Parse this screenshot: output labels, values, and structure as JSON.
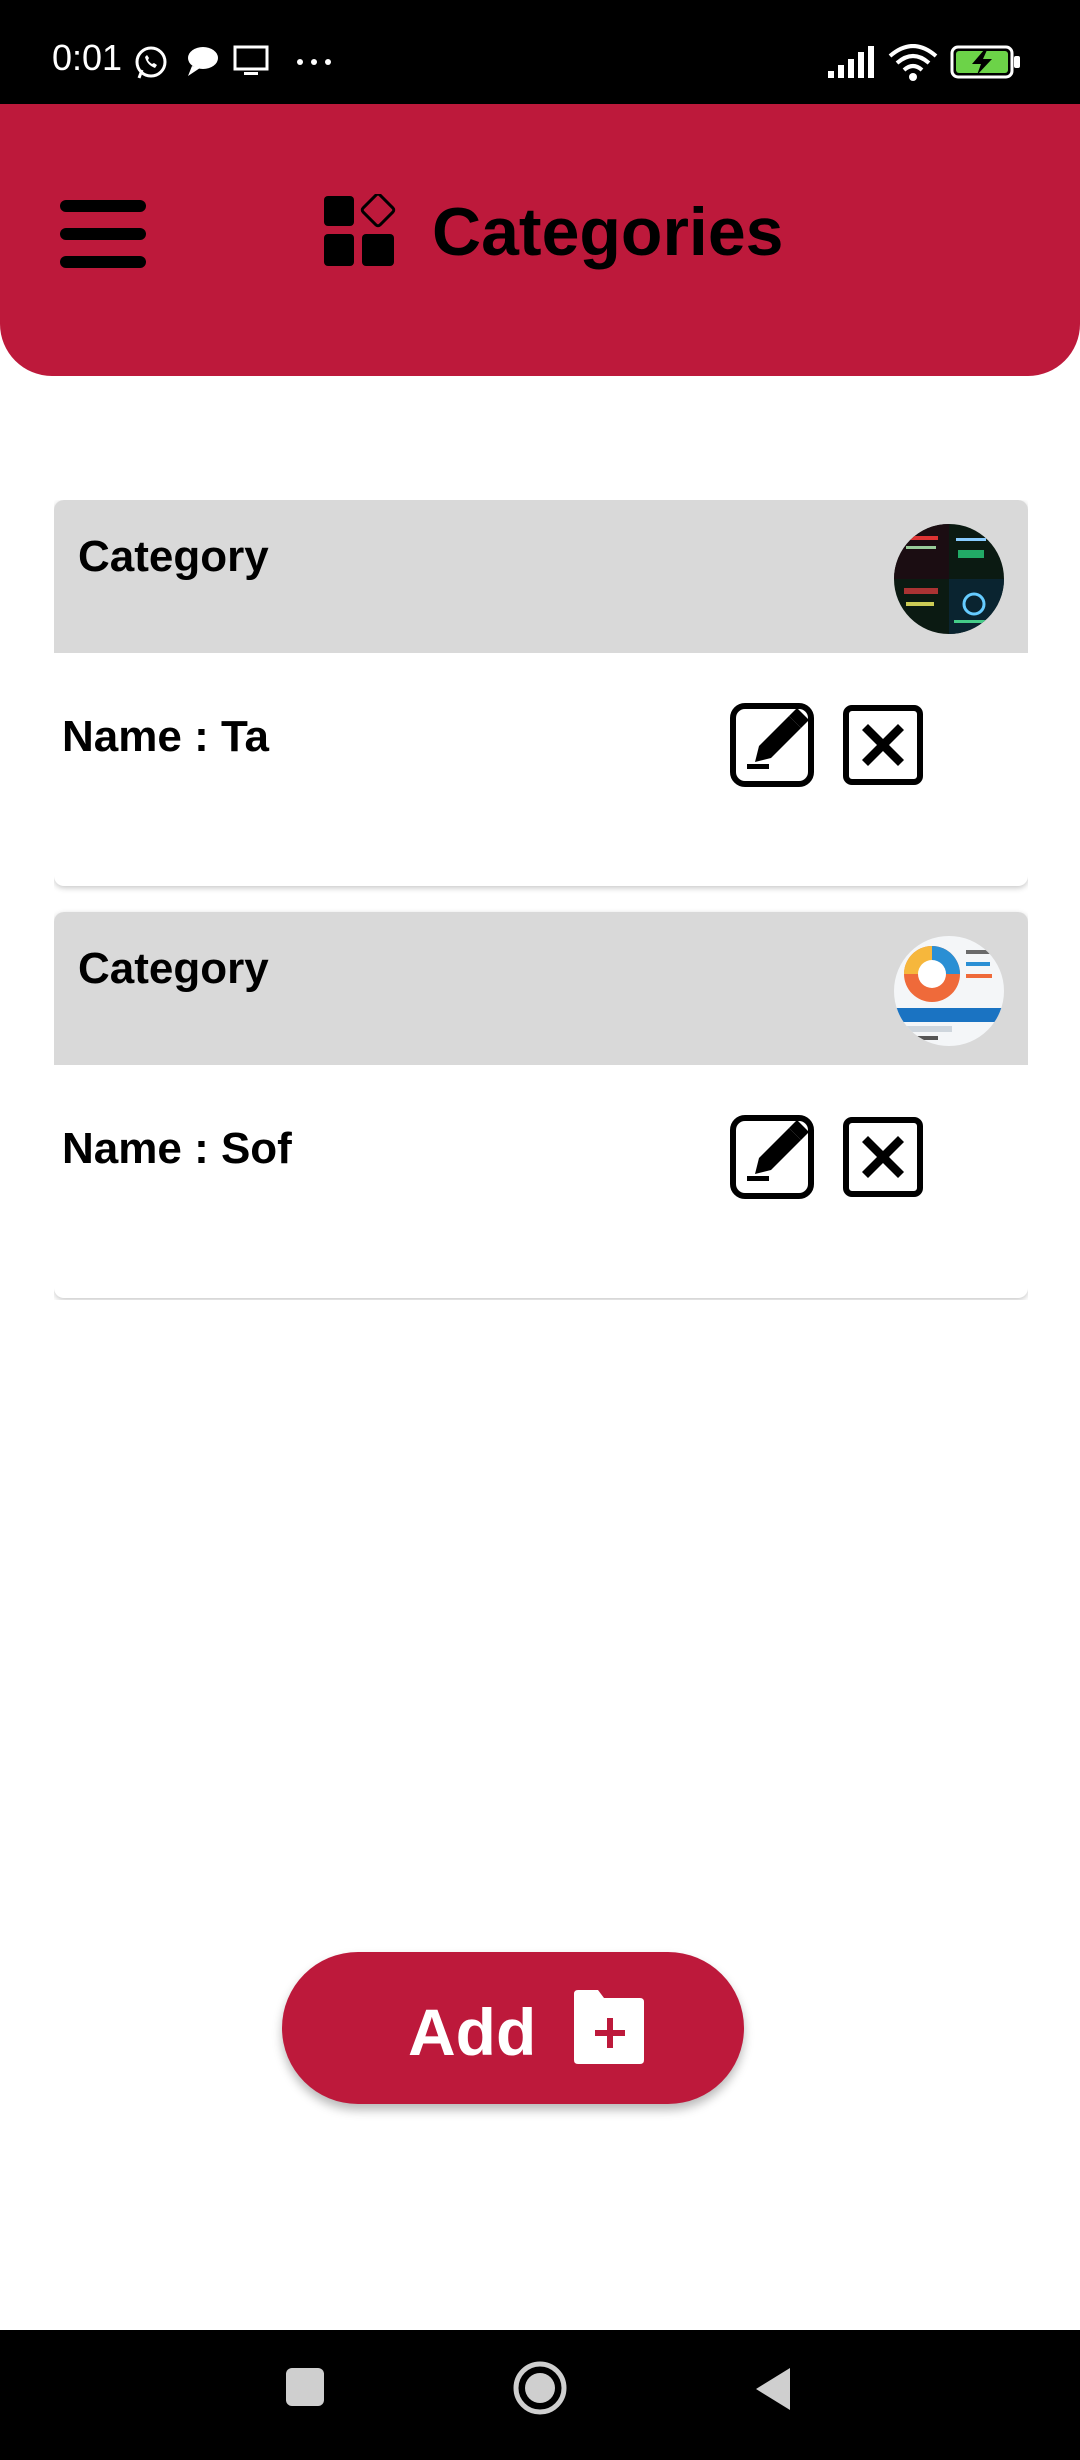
{
  "status_bar": {
    "time": "0:01",
    "icons": [
      "whatsapp-icon",
      "chat-bubble-icon",
      "screen-cast-icon",
      "more-dots-icon",
      "signal-icon",
      "wifi-icon",
      "battery-charging-icon"
    ]
  },
  "app_bar": {
    "title": "Categories",
    "menu_icon": "hamburger-menu-icon",
    "title_icon": "categories-icon"
  },
  "categories": [
    {
      "header": "Category",
      "name_label": "Name : Ta",
      "thumbnail": "dark-infographic-thumbnail"
    },
    {
      "header": "Category",
      "name_label": "Name : Sof",
      "thumbnail": "circular-diagram-thumbnail"
    }
  ],
  "add_button": {
    "label": "Add",
    "icon": "add-file-icon"
  },
  "nav_bar": {
    "buttons": [
      "recents-square-icon",
      "home-circle-icon",
      "back-triangle-icon"
    ]
  },
  "colors": {
    "brand": "#bd193b",
    "card_header": "#d9d9d9",
    "background": "#ffffff",
    "system_bars": "#000000"
  }
}
